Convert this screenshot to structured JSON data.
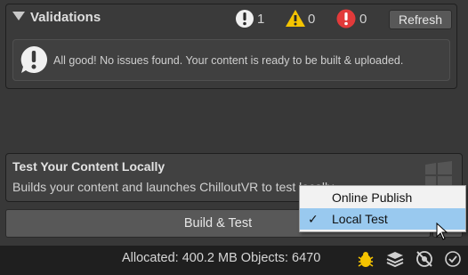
{
  "validations": {
    "title": "Validations",
    "info_count": "1",
    "warning_count": "0",
    "error_count": "0",
    "refresh_label": "Refresh",
    "message": "All good! No issues found. Your content is ready to be built & uploaded."
  },
  "test_locally": {
    "title": "Test Your Content Locally",
    "description": "Builds your content and launches ChilloutVR to test locally."
  },
  "build_button": {
    "label": "Build & Test"
  },
  "menu": {
    "items": [
      {
        "label": "Online Publish",
        "checked": false
      },
      {
        "label": "Local Test",
        "checked": true
      }
    ]
  },
  "status_bar": {
    "text": "Allocated: 400.2 MB Objects: 6470"
  },
  "colors": {
    "warning": "#f5c400",
    "error": "#e23a3a",
    "info": "#f0f0f0",
    "menu_highlight": "#99c9ef"
  },
  "icons": [
    "foldout-arrow-icon",
    "info-icon",
    "warning-icon",
    "error-icon",
    "windows-icon",
    "bug-icon",
    "layers-icon",
    "visibility-icon",
    "check-circle-icon",
    "cursor-icon"
  ]
}
